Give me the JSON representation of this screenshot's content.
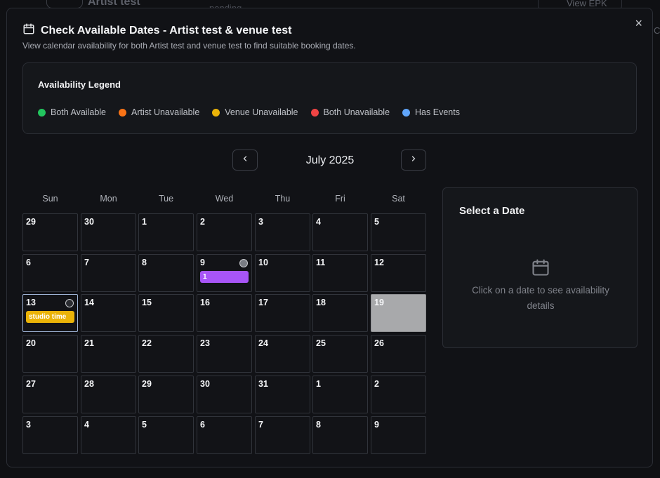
{
  "background": {
    "artist_title": "Artist test",
    "pending_text": "pending",
    "view_epk": "View EPK"
  },
  "modal": {
    "title": "Check Available Dates - Artist test & venue test",
    "subtitle": "View calendar availability for both Artist test and venue test to find suitable booking dates.",
    "close_label": "×"
  },
  "legend": {
    "title": "Availability Legend",
    "items": [
      {
        "label": "Both Available",
        "color": "#22c55e"
      },
      {
        "label": "Artist Unavailable",
        "color": "#f97316"
      },
      {
        "label": "Venue Unavailable",
        "color": "#eab308"
      },
      {
        "label": "Both Unavailable",
        "color": "#ef4444"
      },
      {
        "label": "Has Events",
        "color": "#60a5fa"
      }
    ]
  },
  "calendar": {
    "month_label": "July 2025",
    "weekdays": [
      "Sun",
      "Mon",
      "Tue",
      "Wed",
      "Thu",
      "Fri",
      "Sat"
    ],
    "days": [
      "29",
      "30",
      "1",
      "2",
      "3",
      "4",
      "5",
      "6",
      "7",
      "8",
      "9",
      "10",
      "11",
      "12",
      "13",
      "14",
      "15",
      "16",
      "17",
      "18",
      "19",
      "20",
      "21",
      "22",
      "23",
      "24",
      "25",
      "26",
      "27",
      "28",
      "29",
      "30",
      "31",
      "1",
      "2",
      "3",
      "4",
      "5",
      "6",
      "7",
      "8",
      "9"
    ],
    "events": {
      "day9": "1",
      "day13": "studio time"
    }
  },
  "side_panel": {
    "title": "Select a Date",
    "hint": "Click on a date to see availability details"
  }
}
